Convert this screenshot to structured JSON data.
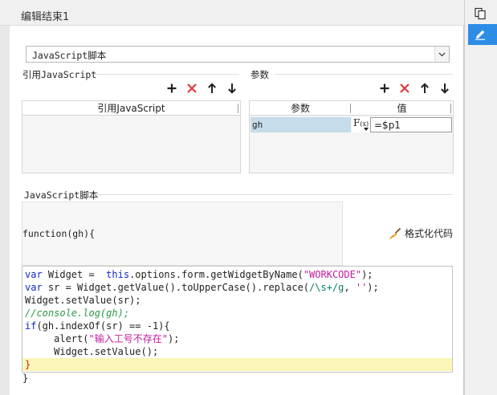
{
  "dialog": {
    "title": "编辑结束1"
  },
  "script_type": {
    "selected": "JavaScript脚本"
  },
  "ref_js": {
    "section_label": "引用JavaScript",
    "column_header": "引用JavaScript",
    "rows": []
  },
  "params": {
    "section_label": "参数",
    "headers": {
      "name": "参数",
      "value": "值"
    },
    "rows": [
      {
        "name": "gh",
        "fx_main": "F",
        "fx_sub": "(x)",
        "value": "=$p1"
      }
    ]
  },
  "toolbar_icons": [
    "plus-icon",
    "delete-x-icon",
    "arrow-up-icon",
    "arrow-down-icon"
  ],
  "js_script": {
    "section_label": "JavaScript脚本",
    "signature": "function(gh){",
    "format_button": "格式化代码",
    "closing": "}",
    "code": {
      "l1_kw1": "var",
      "l1_t1": " Widget =  ",
      "l1_kw2": "this",
      "l1_t2": ".options.form.getWidgetByName(",
      "l1_str": "\"WORKCODE\"",
      "l1_t3": ");",
      "l2_kw": "var",
      "l2_t1": " sr = Widget.getValue().toUpperCase().replace(",
      "l2_rgx": "/\\s+/g",
      "l2_t2": ", ",
      "l2_str": "''",
      "l2_t3": ");",
      "l3": "Widget.setValue(sr);",
      "l4": "//console.log(gh);",
      "l5_kw": "if",
      "l5_t": "(gh.indexOf(sr) == -1){",
      "l6_t1": "     alert(",
      "l6_str": "\"输入工号不存在\"",
      "l6_t2": ");",
      "l7": "     Widget.setValue();",
      "l8": "}"
    }
  },
  "colors": {
    "accent": "#2d8ce6",
    "delete": "#e03a3a",
    "keyword": "#1226c8",
    "string": "#c31b9d",
    "comment": "#2b9a47",
    "highlight_line": "#fbf6b7"
  }
}
